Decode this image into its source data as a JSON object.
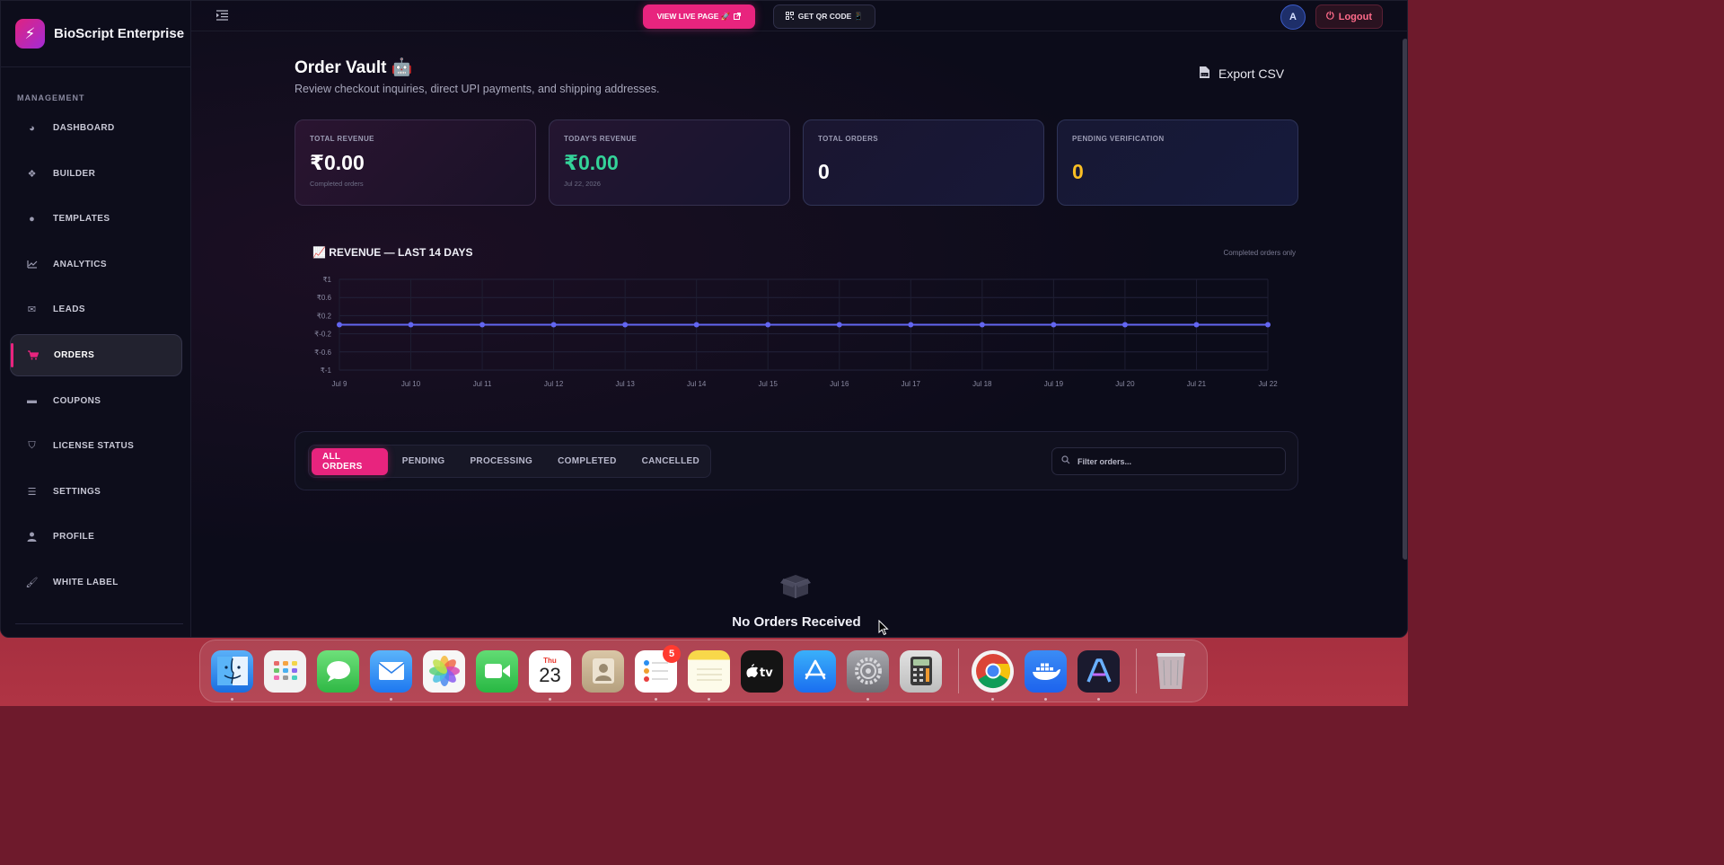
{
  "brand": {
    "name": "BioScript Enterprise",
    "logo_icon": "bolt-icon"
  },
  "sidebar": {
    "section_label": "MANAGEMENT",
    "items": [
      {
        "label": "DASHBOARD",
        "icon": "pie-chart-icon"
      },
      {
        "label": "BUILDER",
        "icon": "cubes-icon"
      },
      {
        "label": "TEMPLATES",
        "icon": "palette-icon"
      },
      {
        "label": "ANALYTICS",
        "icon": "line-chart-icon"
      },
      {
        "label": "LEADS",
        "icon": "envelope-icon"
      },
      {
        "label": "ORDERS",
        "icon": "cart-icon",
        "active": true
      },
      {
        "label": "COUPONS",
        "icon": "ticket-icon"
      },
      {
        "label": "LICENSE STATUS",
        "icon": "shield-icon"
      },
      {
        "label": "SETTINGS",
        "icon": "sliders-icon"
      },
      {
        "label": "PROFILE",
        "icon": "user-icon"
      },
      {
        "label": "WHITE LABEL",
        "icon": "brush-icon"
      }
    ]
  },
  "topbar": {
    "live_label": "VIEW LIVE PAGE 🚀",
    "qr_label": "GET QR CODE 📱",
    "avatar_initial": "A",
    "logout_label": "Logout"
  },
  "page": {
    "title": "Order Vault 🤖",
    "subtitle": "Review checkout inquiries, direct UPI payments, and shipping addresses.",
    "export_label": "Export CSV"
  },
  "stats": [
    {
      "label": "TOTAL REVENUE",
      "value": "₹0.00",
      "note": "Completed orders"
    },
    {
      "label": "TODAY'S REVENUE",
      "value": "₹0.00",
      "note": "Jul 22, 2026"
    },
    {
      "label": "TOTAL ORDERS",
      "value": "0"
    },
    {
      "label": "PENDING VERIFICATION",
      "value": "0"
    }
  ],
  "chart": {
    "title": "📈 REVENUE — LAST 14 DAYS",
    "note": "Completed orders only"
  },
  "chart_data": {
    "type": "line",
    "title": "REVENUE — LAST 14 DAYS",
    "categories": [
      "Jul 9",
      "Jul 10",
      "Jul 11",
      "Jul 12",
      "Jul 13",
      "Jul 14",
      "Jul 15",
      "Jul 16",
      "Jul 17",
      "Jul 18",
      "Jul 19",
      "Jul 20",
      "Jul 21",
      "Jul 22"
    ],
    "series": [
      {
        "values": [
          0,
          0,
          0,
          0,
          0,
          0,
          0,
          0,
          0,
          0,
          0,
          0,
          0,
          0
        ],
        "color": "#6366f1"
      }
    ],
    "yticks": [
      "₹1",
      "₹0.6",
      "₹0.2",
      "₹-0.2",
      "₹-0.6",
      "₹-1"
    ],
    "ylim": [
      -1,
      1
    ],
    "grid": true
  },
  "filters": {
    "tabs": [
      "ALL ORDERS",
      "PENDING",
      "PROCESSING",
      "COMPLETED",
      "CANCELLED"
    ],
    "active_tab": "ALL ORDERS",
    "search_placeholder": "Filter orders..."
  },
  "empty_state": {
    "title": "No Orders Received"
  },
  "dock": {
    "apps": [
      {
        "name": "Finder",
        "icon": "finder-icon",
        "color": "#3b8cf0",
        "running": true
      },
      {
        "name": "Launchpad",
        "icon": "launchpad-icon",
        "color": "#f2f2f2"
      },
      {
        "name": "Messages",
        "icon": "messages-icon",
        "color": "#34c759"
      },
      {
        "name": "Mail",
        "icon": "mail-icon",
        "color": "#2f8cf5",
        "running": true
      },
      {
        "name": "Photos",
        "icon": "photos-icon",
        "color": "#f5f5f5"
      },
      {
        "name": "FaceTime",
        "icon": "facetime-icon",
        "color": "#2fc45a"
      },
      {
        "name": "Calendar",
        "icon": "calendar-icon",
        "color": "#ffffff",
        "month": "Thu",
        "day": "23",
        "running": true
      },
      {
        "name": "Contacts",
        "icon": "contacts-icon",
        "color": "#c8b59a"
      },
      {
        "name": "Reminders",
        "icon": "reminders-icon",
        "color": "#ffffff",
        "badge": "5",
        "running": true
      },
      {
        "name": "Notes",
        "icon": "notes-icon",
        "color": "#f7d24a",
        "running": true
      },
      {
        "name": "TV",
        "icon": "tv-icon",
        "color": "#111111"
      },
      {
        "name": "App Store",
        "icon": "appstore-icon",
        "color": "#1e8ff0"
      },
      {
        "name": "System Settings",
        "icon": "settings-icon",
        "color": "#8e8e93",
        "running": true
      },
      {
        "name": "Calculator",
        "icon": "calculator-icon",
        "color": "#d0d0d0"
      }
    ],
    "recent_apps": [
      {
        "name": "Chrome",
        "icon": "chrome-icon",
        "color": "#ffffff",
        "running": true
      },
      {
        "name": "Docker",
        "icon": "docker-icon",
        "color": "#1d63ed",
        "running": true
      },
      {
        "name": "Affinity",
        "icon": "affinity-icon",
        "color": "#1a1a2e",
        "running": true
      }
    ],
    "trash": {
      "name": "Trash",
      "icon": "trash-icon"
    }
  },
  "colors": {
    "accent": "#e8247e",
    "green": "#34d399",
    "yellow": "#fbbf24",
    "line": "#6366f1"
  }
}
